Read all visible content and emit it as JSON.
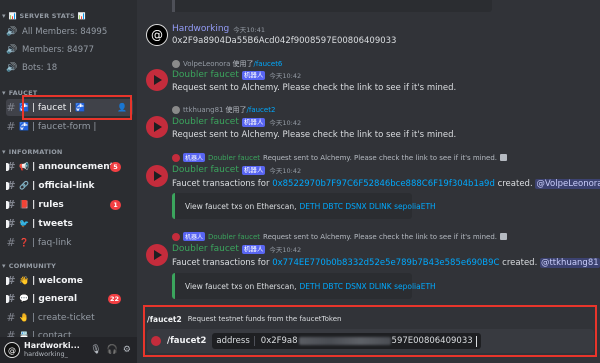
{
  "sidebar": {
    "server_stats_header": "📊 SERVER STATS 📊",
    "stats": [
      {
        "icon": "speaker-icon",
        "label": "All Members: 84995"
      },
      {
        "icon": "speaker-icon",
        "label": "Members: 84977"
      },
      {
        "icon": "speaker-icon",
        "label": "Bots: 18"
      }
    ],
    "faucet_category": "FAUCET",
    "faucet_channels": [
      {
        "label": "| faucet |",
        "active": true
      },
      {
        "label": "| faucet-form |",
        "active": false
      }
    ],
    "information_category": "INFORMATION",
    "information_channels": [
      {
        "emoji": "📢",
        "label": "| announcement",
        "badge": "5",
        "bold": true
      },
      {
        "emoji": "🔗",
        "label": "| official-link",
        "badge": "",
        "bold": true
      },
      {
        "emoji": "📕",
        "label": "| rules",
        "badge": "1",
        "bold": true
      },
      {
        "emoji": "🐦",
        "label": "| tweets",
        "badge": "",
        "bold": true
      },
      {
        "emoji": "❓",
        "label": "| faq-link",
        "badge": "",
        "bold": false
      }
    ],
    "community_category": "COMMUNITY",
    "community_channels": [
      {
        "emoji": "👋",
        "label": "| welcome",
        "badge": "",
        "bold": true
      },
      {
        "emoji": "💬",
        "label": "| general",
        "badge": "22",
        "bold": true
      },
      {
        "emoji": "🤚",
        "label": "| create-ticket",
        "badge": "",
        "bold": false
      },
      {
        "emoji": "📇",
        "label": "| contact",
        "badge": "",
        "bold": false
      }
    ],
    "user": {
      "name": "Hardworki...",
      "sub": "hardworking_"
    }
  },
  "messages": [
    {
      "author": "Hardworking",
      "time": "今天10:41",
      "text": "0x2F9a8904Da55B6Acd042f9008597E00806409033"
    },
    {
      "reply_user": "VolpeLeonora",
      "reply_used": "使用了",
      "reply_cmd": "/faucet6",
      "author": "Doubler faucet",
      "tag": "机器人",
      "time": "今天10:42",
      "text": "Request sent to Alchemy. Please check the link to see if it's mined."
    },
    {
      "reply_user": "ttkhuang81",
      "reply_used": "使用了",
      "reply_cmd": "/faucet2",
      "author": "Doubler faucet",
      "tag": "机器人",
      "time": "今天10:42",
      "text": "Request sent to Alchemy. Please check the link to see if it's mined."
    },
    {
      "reply_tag": "机器人",
      "reply_name": "Doubler faucet",
      "reply_text": "Request sent to Alchemy. Please check the link to see if it's mined.",
      "author": "Doubler faucet",
      "tag": "机器人",
      "time": "今天10:42",
      "text_prefix": "Faucet transactions for ",
      "tx": "0x8522970b7F97C6F52846bce888C6F19f304b1a9d",
      "text_mid": " created. ",
      "mention": "@VolpeLeonora",
      "embed_label": "View faucet txs on Etherscan,",
      "embed_links": "DETH DBTC DSNX DLINK sepoliaETH"
    },
    {
      "reply_tag": "机器人",
      "reply_name": "Doubler faucet",
      "reply_text": "Request sent to Alchemy. Please check the link to see if it's mined.",
      "author": "Doubler faucet",
      "tag": "机器人",
      "time": "今天10:42",
      "text_prefix": "Faucet transactions for ",
      "tx": "0x774EE770b0b8332d52e5e789b7B43e585e690B9C",
      "text_mid": " created. ",
      "mention": "@ttkhuang81",
      "embed_label": "View faucet txs on Etherscan,",
      "embed_links": "DETH DBTC DSNX DLINK sepoliaETH"
    }
  ],
  "command": {
    "name": "/faucet2",
    "description": "Request testnet funds from the faucetToken",
    "option_key": "address",
    "option_value_start": "0x2F9a8",
    "option_value_end": "597E00806409033"
  },
  "colors": {
    "accent_red": "#e8352b",
    "bot_green": "#3ba55d",
    "link_blue": "#00a8fc"
  }
}
